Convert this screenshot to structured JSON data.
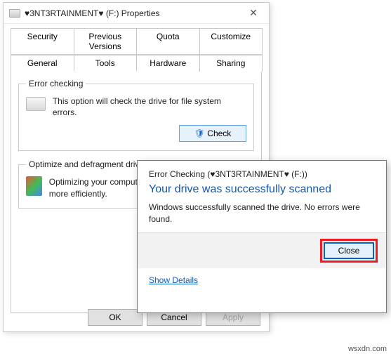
{
  "propWindow": {
    "title": "♥3NT3RTAINMENT♥ (F:) Properties",
    "tabsRow1": [
      "Security",
      "Previous Versions",
      "Quota",
      "Customize"
    ],
    "tabsRow2": [
      "General",
      "Tools",
      "Hardware",
      "Sharing"
    ],
    "activeTab": "Tools",
    "errorChecking": {
      "legend": "Error checking",
      "desc": "This option will check the drive for file system errors.",
      "button": "Check"
    },
    "optimize": {
      "legend": "Optimize and defragment drive",
      "desc": "Optimizing your computer's drives can help it run more efficiently."
    },
    "buttons": {
      "ok": "OK",
      "cancel": "Cancel",
      "apply": "Apply"
    }
  },
  "dialog": {
    "title": "Error Checking (♥3NT3RTAINMENT♥ (F:))",
    "heading": "Your drive was successfully scanned",
    "body": "Windows successfully scanned the drive. No errors were found.",
    "close": "Close",
    "showDetails": "Show Details"
  },
  "watermark": "wsxdn.com"
}
